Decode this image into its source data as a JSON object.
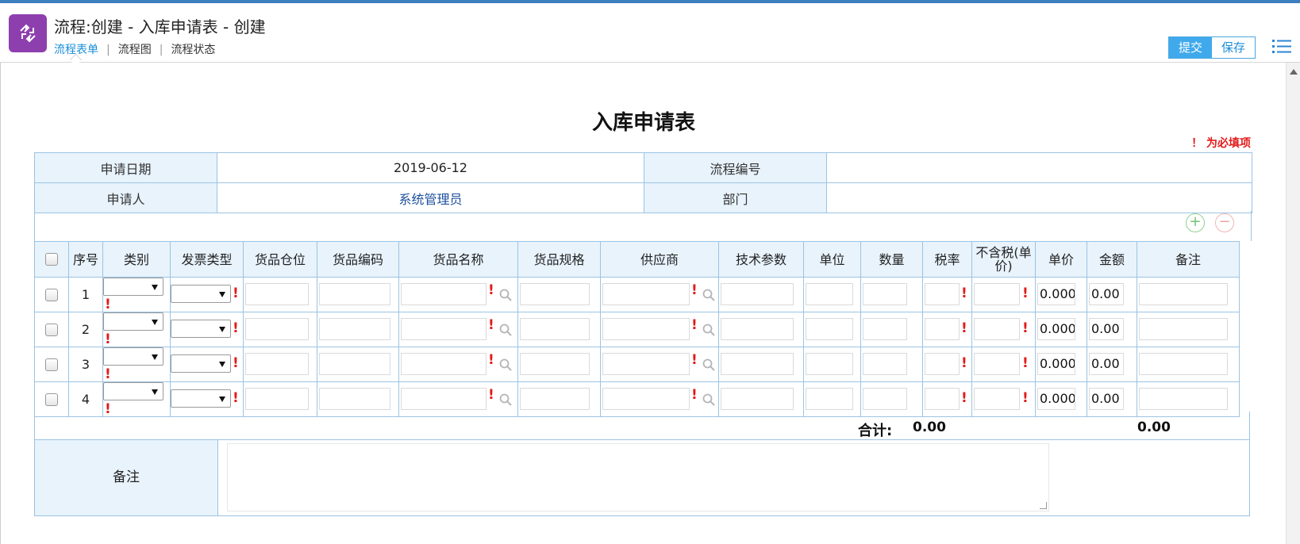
{
  "header": {
    "title": "流程:创建 - 入库申请表 - 创建",
    "tabs": [
      {
        "label": "流程表单",
        "active": true
      },
      {
        "label": "流程图",
        "active": false
      },
      {
        "label": "流程状态",
        "active": false
      }
    ],
    "separator": "|",
    "submit_label": "提交",
    "save_label": "保存",
    "menu_icon": "list-menu-icon",
    "accent_color": "#3fa9ec",
    "app_icon_color": "#8e3fae"
  },
  "form": {
    "title": "入库申请表",
    "required_note": "！ 为必填项",
    "info": {
      "apply_date_label": "申请日期",
      "apply_date_value": "2019-06-12",
      "flow_no_label": "流程编号",
      "flow_no_value": "",
      "applicant_label": "申请人",
      "applicant_value": "系统管理员",
      "dept_label": "部门",
      "dept_value": ""
    },
    "columns": {
      "seq": "序号",
      "category": "类别",
      "invoice_type": "发票类型",
      "warehouse": "货品仓位",
      "item_code": "货品编码",
      "item_name": "货品名称",
      "item_spec": "货品规格",
      "supplier": "供应商",
      "tech_params": "技术参数",
      "unit": "单位",
      "quantity": "数量",
      "tax_rate": "税率",
      "unit_price_ex_tax": "不含税(单价)",
      "unit_price": "单价",
      "amount": "金额",
      "remark": "备注"
    },
    "rows": [
      {
        "seq": "1",
        "unit_price": "0.0000",
        "amount": "0.00"
      },
      {
        "seq": "2",
        "unit_price": "0.0000",
        "amount": "0.00"
      },
      {
        "seq": "3",
        "unit_price": "0.0000",
        "amount": "0.00"
      },
      {
        "seq": "4",
        "unit_price": "0.0000",
        "amount": "0.00"
      }
    ],
    "required_mark": "!",
    "totals": {
      "label": "合计:",
      "unit_price_ex_tax_total": "0.00",
      "amount_total": "0.00"
    },
    "remark_label": "备注",
    "remark_value": "",
    "add_symbol": "+",
    "remove_symbol": "−"
  }
}
